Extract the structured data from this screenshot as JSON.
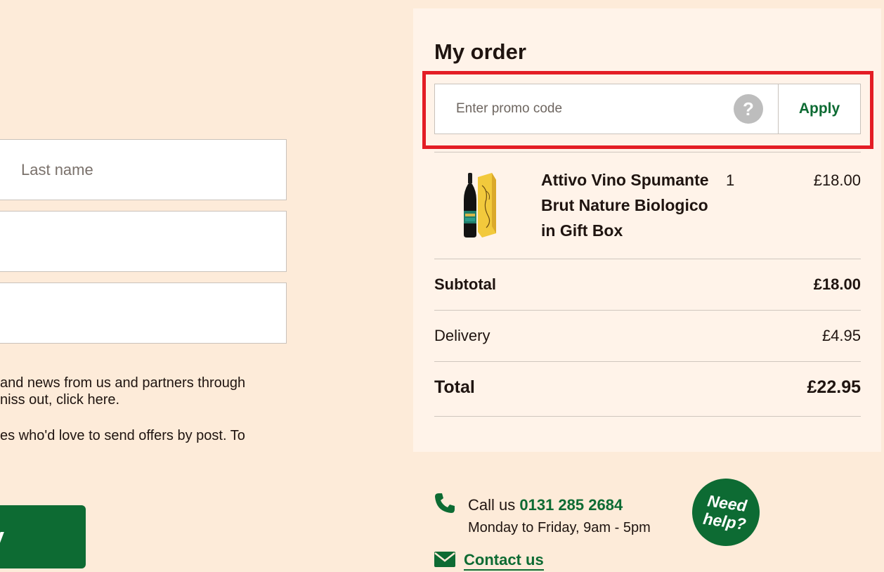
{
  "form": {
    "last_name_placeholder": "Last name",
    "field2_value": "",
    "field3_value": "",
    "consent_1_line1": "and news from us and partners through",
    "consent_1_line2": "niss out, click here.",
    "consent_2_line1": "es who'd love to send offers by post. To",
    "submit_label": "y"
  },
  "order": {
    "title": "My order",
    "promo": {
      "placeholder": "Enter promo code",
      "help_glyph": "?",
      "apply_label": "Apply",
      "highlight_color": "#e31d25"
    },
    "item": {
      "name": "Attivo Vino Spumante Brut Nature Biologico in Gift Box",
      "quantity": "1",
      "price": "£18.00",
      "image_icon": "wine-bottle-gift-box"
    },
    "subtotal_label": "Subtotal",
    "subtotal_value": "£18.00",
    "delivery_label": "Delivery",
    "delivery_value": "£4.95",
    "total_label": "Total",
    "total_value": "£22.95"
  },
  "help": {
    "call_prefix": "Call us",
    "phone_number": "0131 285 2684",
    "hours": "Monday to Friday, 9am - 5pm",
    "contact_label": "Contact us",
    "badge_line1": "Need",
    "badge_line2": "help?",
    "icons": [
      "phone-icon",
      "mail-icon"
    ]
  },
  "colors": {
    "page_bg": "#fdebd9",
    "panel_bg": "#fff3e9",
    "brand_green": "#0d6b33",
    "text": "#1f1410"
  }
}
